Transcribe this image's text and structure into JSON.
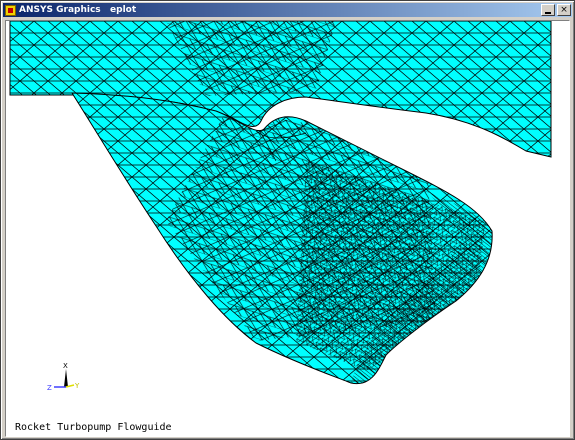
{
  "window": {
    "title": "ANSYS Graphics   eplot",
    "minimize_icon": "minimize-icon",
    "close_label": "×"
  },
  "viewport": {
    "caption": "Rocket Turbopump Flowguide",
    "background_color": "#ffffff",
    "mesh_fill_color": "#00ffff",
    "mesh_line_color": "#000000",
    "triad": {
      "x_label": "X",
      "y_label": "Y",
      "z_label": "Z",
      "x_color": "#000000",
      "y_color": "#e0e000",
      "z_color": "#4040ff"
    }
  }
}
